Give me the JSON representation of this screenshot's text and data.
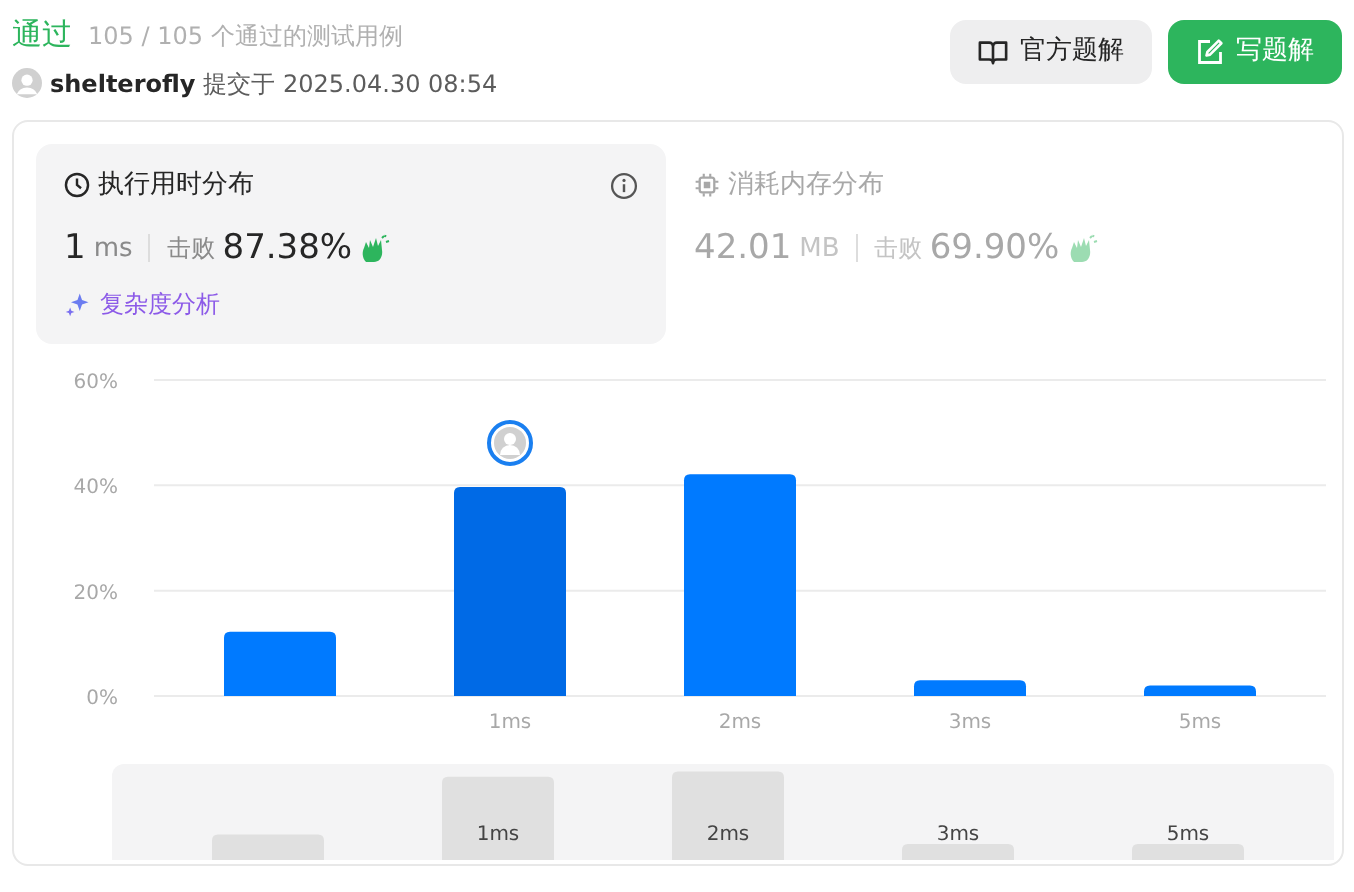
{
  "result": {
    "status": "通过",
    "summary": "105 / 105 个通过的测试用例"
  },
  "submission": {
    "user": "shelterofly",
    "submitted": "提交于 2025.04.30 08:54"
  },
  "buttons": [
    {
      "label": "官方题解",
      "kind": "secondary"
    },
    {
      "label": "写题解",
      "kind": "primary"
    }
  ],
  "tabs": [
    {
      "title": "执行用时分布",
      "value": "1",
      "unit": "ms",
      "beats_label": "击败",
      "beats": "87.38%",
      "selected": true,
      "kind": "time"
    },
    {
      "title": "消耗内存分布",
      "value": "42.01",
      "unit": "MB",
      "beats_label": "击败",
      "beats": "69.90%",
      "selected": false,
      "kind": "memory"
    }
  ],
  "complexity_link": "复杂度分析",
  "chart_data": {
    "type": "bar",
    "categories": [
      null,
      "1ms",
      "2ms",
      "3ms",
      "5ms"
    ],
    "series": [
      {
        "color": "#007aff",
        "values": [
          12.2,
          null,
          42.1,
          3.0,
          2.0
        ]
      },
      {
        "color": "#006ae6",
        "values": [
          null,
          39.7,
          null,
          null,
          null
        ]
      }
    ],
    "ylim": [
      0,
      60
    ],
    "yticks": [
      {
        "value": 0,
        "label": "0%"
      },
      {
        "value": 20,
        "label": "20%"
      },
      {
        "value": 40,
        "label": "40%"
      },
      {
        "value": 60,
        "label": "60%"
      }
    ]
  },
  "overview": {
    "bars": [
      {
        "kind": "blank"
      },
      {
        "kind": "labeled",
        "label": "1ms"
      },
      {
        "kind": "labeled",
        "label": "2ms"
      },
      {
        "kind": "labeled",
        "label": "3ms"
      },
      {
        "kind": "labeled",
        "label": "5ms"
      }
    ]
  }
}
